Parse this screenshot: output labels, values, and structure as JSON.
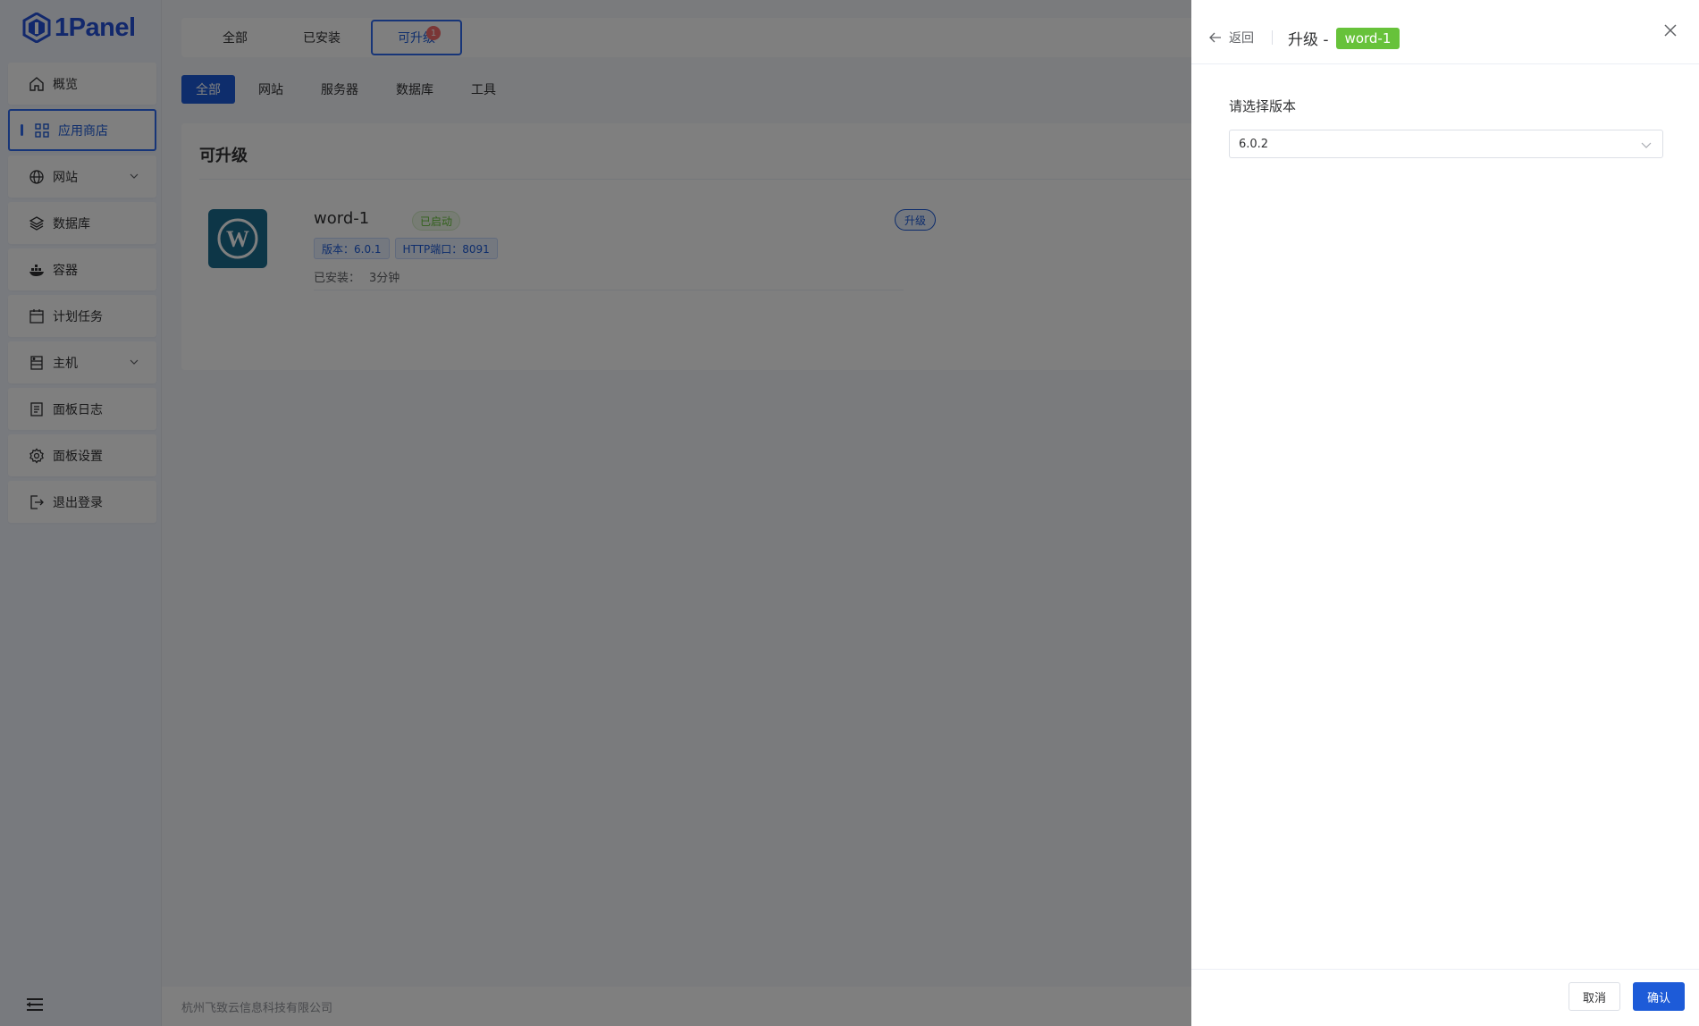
{
  "sidebar": {
    "logo_text": "1Panel",
    "items": [
      {
        "label": "概览",
        "icon": "home-icon"
      },
      {
        "label": "应用商店",
        "icon": "grid-icon"
      },
      {
        "label": "网站",
        "icon": "globe-icon"
      },
      {
        "label": "数据库",
        "icon": "layers-icon"
      },
      {
        "label": "容器",
        "icon": "docker-icon"
      },
      {
        "label": "计划任务",
        "icon": "calendar-icon"
      },
      {
        "label": "主机",
        "icon": "server-icon"
      },
      {
        "label": "面板日志",
        "icon": "log-icon"
      },
      {
        "label": "面板设置",
        "icon": "gear-icon"
      },
      {
        "label": "退出登录",
        "icon": "logout-icon"
      }
    ]
  },
  "top_tabs": [
    {
      "label": "全部"
    },
    {
      "label": "已安装"
    },
    {
      "label": "可升级",
      "badge": "1"
    }
  ],
  "categories": [
    "全部",
    "网站",
    "服务器",
    "数据库",
    "工具"
  ],
  "panel": {
    "title": "可升级",
    "app": {
      "name": "word-1",
      "status": "已启动",
      "version_tag": "版本：6.0.1",
      "port_tag": "HTTP端口：8091",
      "installed_label": "已安装：",
      "installed_value": "3分钟",
      "upgrade_label": "升级"
    }
  },
  "footer": {
    "company": "杭州飞致云信息科技有限公司"
  },
  "drawer": {
    "back_label": "返回",
    "title_prefix": "升级 -",
    "title_tag": "word-1",
    "field_label": "请选择版本",
    "selected_version": "6.0.2",
    "cancel_label": "取消",
    "confirm_label": "确认"
  },
  "colors": {
    "accent": "#1d5bd8",
    "success": "#67c23a",
    "danger": "#f56c6c"
  }
}
